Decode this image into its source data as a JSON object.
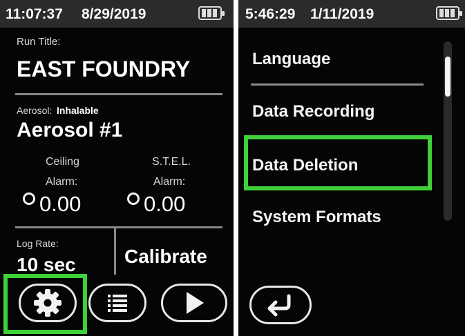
{
  "left_screen": {
    "status": {
      "time": "11:07:37",
      "date": "8/29/2019",
      "battery_icon": "battery-full-icon"
    },
    "run_title": {
      "label": "Run Title:",
      "value": "EAST FOUNDRY"
    },
    "aerosol": {
      "label": "Aerosol:",
      "type": "Inhalable",
      "value": "Aerosol #1"
    },
    "ceiling": {
      "title": "Ceiling",
      "alarm_label": "Alarm:",
      "value": "0.00"
    },
    "stel": {
      "title": "S.T.E.L.",
      "alarm_label": "Alarm:",
      "value": "0.00"
    },
    "log_rate": {
      "label": "Log Rate:",
      "value": "10 sec"
    },
    "calibrate_label": "Calibrate",
    "bottom_buttons": [
      {
        "icon": "gear-icon",
        "highlighted": true
      },
      {
        "icon": "list-icon"
      },
      {
        "icon": "play-icon"
      }
    ]
  },
  "right_screen": {
    "status": {
      "time": "5:46:29",
      "date": "1/11/2019",
      "battery_icon": "battery-full-icon"
    },
    "menu_items": [
      "Language",
      "Data Recording",
      "Data Deletion",
      "System Formats"
    ],
    "highlighted_item": "Data Deletion",
    "back_icon": "back-arrow-icon"
  },
  "colors": {
    "highlight": "#3ed13a",
    "screen_bg": "#050505",
    "status_bar": "#2b2b2b"
  }
}
